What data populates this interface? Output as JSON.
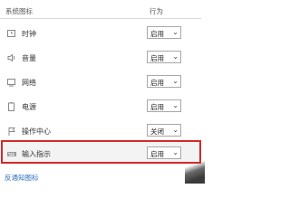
{
  "header": {
    "icons_label": "系统图标",
    "behavior_label": "行为"
  },
  "rows": [
    {
      "icon": "clock-icon",
      "label": "时钟",
      "value": "启用"
    },
    {
      "icon": "volume-icon",
      "label": "音量",
      "value": "启用"
    },
    {
      "icon": "network-icon",
      "label": "网络",
      "value": "启用"
    },
    {
      "icon": "battery-icon",
      "label": "电源",
      "value": "启用"
    },
    {
      "icon": "action-center-flag-icon",
      "label": "操作中心",
      "value": "关闭"
    },
    {
      "icon": "keyboard-icon",
      "label": "输入指示",
      "value": "启用"
    }
  ],
  "footer": {
    "link_text": "反通知图标"
  },
  "colors": {
    "highlight_border": "#d42a2a",
    "link": "#2a6ebd"
  }
}
